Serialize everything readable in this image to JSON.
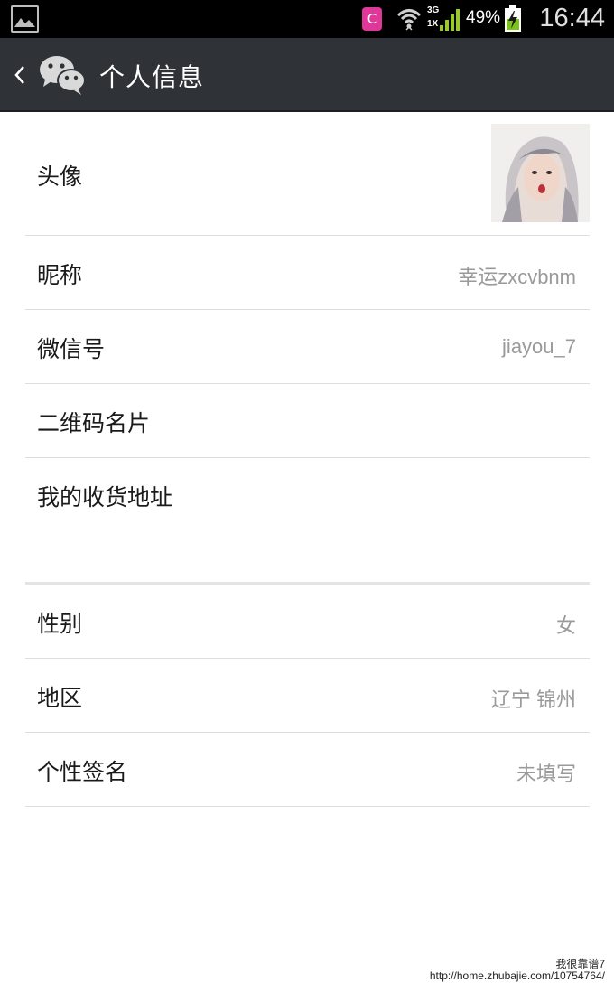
{
  "status_bar": {
    "network": "3G",
    "network2": "1X",
    "app_badge": "C",
    "battery": "49%",
    "time": "16:44"
  },
  "action_bar": {
    "title": "个人信息"
  },
  "profile": {
    "avatar_label": "头像",
    "rows": [
      {
        "label": "昵称",
        "value": "幸运zxcvbnm"
      },
      {
        "label": "微信号",
        "value": "jiayou_7"
      },
      {
        "label": "二维码名片",
        "value": ""
      },
      {
        "label": "我的收货地址",
        "value": ""
      }
    ],
    "rows2": [
      {
        "label": "性别",
        "value": "女"
      },
      {
        "label": "地区",
        "value": "辽宁 锦州"
      },
      {
        "label": "个性签名",
        "value": "未填写"
      }
    ]
  },
  "watermark": {
    "text": "我很靠谱7",
    "url": "http://home.zhubajie.com/10754764/"
  },
  "colors": {
    "action_bar": "#2f3337",
    "status_bar": "#000000",
    "value_text": "#9a9a9a",
    "divider": "#dedede"
  }
}
